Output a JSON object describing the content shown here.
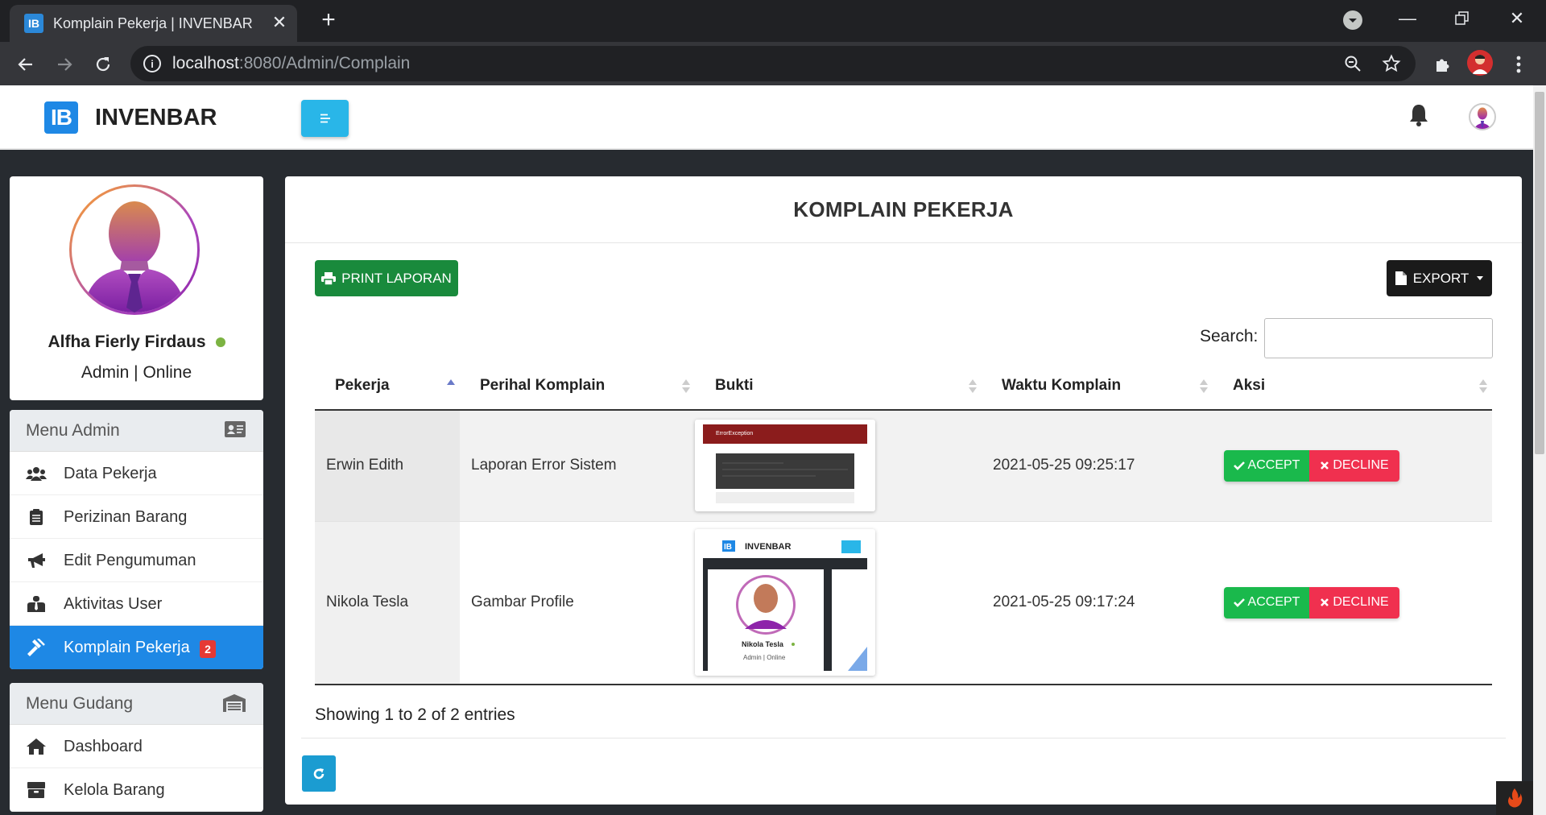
{
  "browser": {
    "tab_title": "Komplain Pekerja | INVENBAR",
    "tab_favicon": "IB",
    "url_host": "localhost",
    "url_path": ":8080/Admin/Complain",
    "omnibox_info": "i"
  },
  "app": {
    "brand_logo": "IB",
    "brand_name": "INVENBAR"
  },
  "user": {
    "name": "Alfha Fierly Firdaus",
    "role": "Admin | Online"
  },
  "menu_admin": {
    "title": "Menu Admin",
    "items": [
      {
        "label": "Data Pekerja",
        "icon": "users-icon"
      },
      {
        "label": "Perizinan Barang",
        "icon": "clipboard-icon"
      },
      {
        "label": "Edit Pengumuman",
        "icon": "bullhorn-icon"
      },
      {
        "label": "Aktivitas User",
        "icon": "user-tie-icon"
      },
      {
        "label": "Komplain Pekerja",
        "icon": "gavel-icon",
        "active": true,
        "badge": "2"
      }
    ]
  },
  "menu_gudang": {
    "title": "Menu Gudang",
    "items": [
      {
        "label": "Dashboard",
        "icon": "home-icon"
      },
      {
        "label": "Kelola Barang",
        "icon": "box-icon"
      }
    ]
  },
  "main": {
    "title": "KOMPLAIN PEKERJA",
    "print_label": "PRINT LAPORAN",
    "export_label": "EXPORT",
    "search_label": "Search:",
    "search_value": "",
    "columns": [
      "Pekerja",
      "Perihal Komplain",
      "Bukti",
      "Waktu Komplain",
      "Aksi"
    ],
    "rows": [
      {
        "pekerja": "Erwin Edith",
        "perihal": "Laporan Error Sistem",
        "bukti": "error-screenshot",
        "waktu": "2021-05-25 09:25:17"
      },
      {
        "pekerja": "Nikola Tesla",
        "perihal": "Gambar Profile",
        "bukti": "profile-screenshot",
        "waktu": "2021-05-25 09:17:24"
      }
    ],
    "accept_label": "ACCEPT",
    "decline_label": "DECLINE",
    "entries_info": "Showing 1 to 2 of 2 entries",
    "thumb2": {
      "brand": "INVENBAR",
      "logo": "IB",
      "name": "Nikola Tesla",
      "role": "Admin | Online"
    },
    "thumb1": {
      "heading": "ErrorException"
    }
  },
  "colors": {
    "accent_blue": "#1e88e5",
    "toggle_cyan": "#29b6e8",
    "print_green": "#198a3c",
    "accept_green": "#1ab94c",
    "decline_red": "#f0304f",
    "badge_red": "#e53935",
    "online_green": "#7cb342"
  }
}
